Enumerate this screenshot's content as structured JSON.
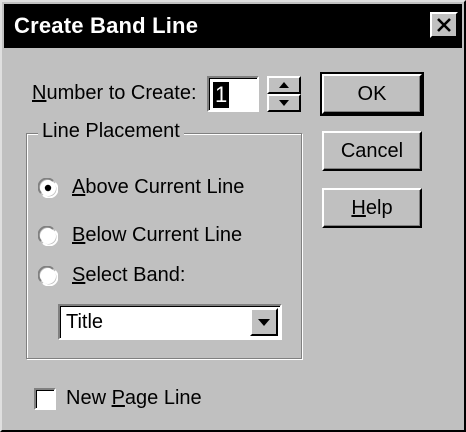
{
  "window": {
    "title": "Create Band Line"
  },
  "number_to_create": {
    "label_pre": "N",
    "label_rest": "umber to Create:",
    "value": "1"
  },
  "buttons": {
    "ok": "OK",
    "cancel": "Cancel",
    "help_underlined": "H",
    "help_rest": "elp"
  },
  "line_placement": {
    "legend": "Line Placement",
    "options": [
      {
        "underlined": "A",
        "rest": "bove Current Line",
        "selected": true
      },
      {
        "underlined": "B",
        "rest": "elow Current Line",
        "selected": false
      },
      {
        "underlined": "S",
        "rest": "elect Band:",
        "selected": false
      }
    ],
    "band_select": {
      "value": "Title"
    }
  },
  "new_page_line": {
    "pre": "New ",
    "underlined": "P",
    "rest": "age Line",
    "checked": false
  },
  "icons": {
    "close": "close-icon",
    "spin_up": "arrow-up-icon",
    "spin_down": "arrow-down-icon",
    "dropdown": "chevron-down-icon"
  }
}
